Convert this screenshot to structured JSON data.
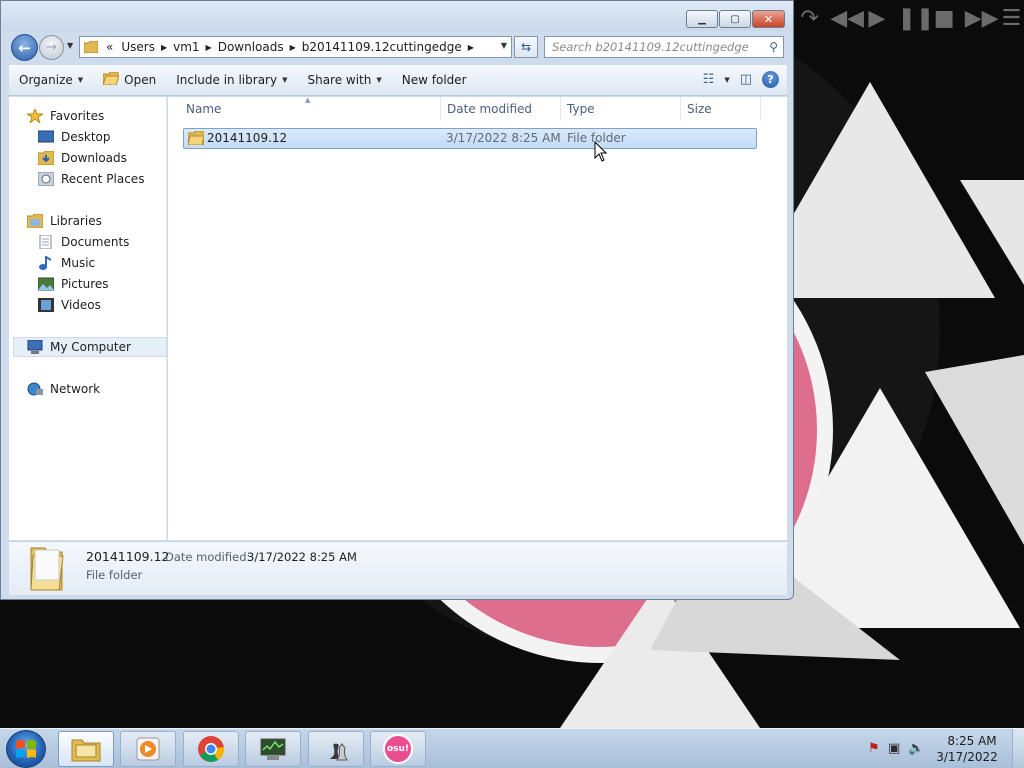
{
  "window": {
    "title": "",
    "controls": {
      "minimize": "▁",
      "maximize": "▢",
      "close": "✕"
    }
  },
  "nav": {
    "history_overflow": "«",
    "breadcrumbs": [
      "Users",
      "vm1",
      "Downloads",
      "b20141109.12cuttingedge"
    ],
    "search_placeholder": "Search b20141109.12cuttingedge"
  },
  "commands": {
    "organize": "Organize",
    "open": "Open",
    "include_in_library": "Include in library",
    "share_with": "Share with",
    "new_folder": "New folder"
  },
  "sidebar": {
    "favorites_header": "Favorites",
    "favorites": [
      "Desktop",
      "Downloads",
      "Recent Places"
    ],
    "libraries_header": "Libraries",
    "libraries": [
      "Documents",
      "Music",
      "Pictures",
      "Videos"
    ],
    "computer": "My Computer",
    "network": "Network"
  },
  "columns": {
    "name": "Name",
    "date_modified": "Date modified",
    "type": "Type",
    "size": "Size"
  },
  "files": [
    {
      "name": "20141109.12",
      "date_modified": "3/17/2022 8:25 AM",
      "type": "File folder",
      "size": ""
    }
  ],
  "details": {
    "name": "20141109.12",
    "date_label": "Date modified:",
    "date_value": "3/17/2022 8:25 AM",
    "type": "File folder"
  },
  "taskbar": {
    "apps": [
      "windows-explorer",
      "media-player",
      "chrome",
      "system-monitor",
      "chess",
      "osu"
    ],
    "osu_label": "osu!",
    "clock_time": "8:25 AM",
    "clock_date": "3/17/2022"
  },
  "colors": {
    "wallpaper": "#0b0b0b",
    "wallpaper_triangles": "#e8e8e8",
    "wallpaper_pink": "#de6e8e",
    "selection": "#c3dbf5",
    "window_frame": "#cfdcec"
  }
}
